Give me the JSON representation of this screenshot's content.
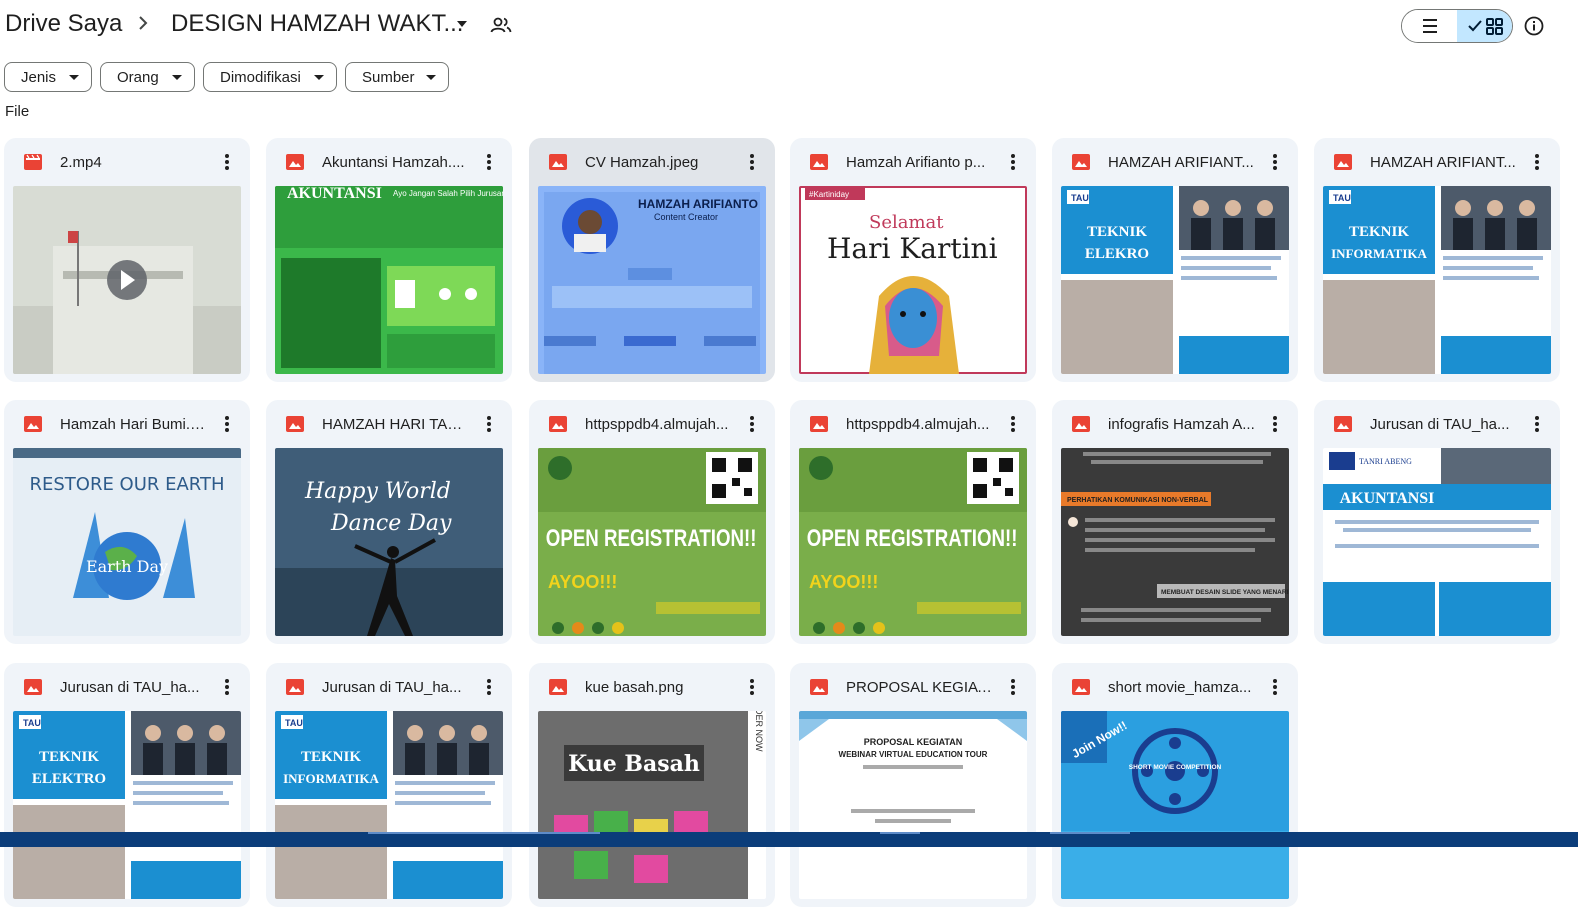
{
  "breadcrumb": {
    "root": "Drive Saya",
    "folder": "DESIGN HAMZAH WAKT..."
  },
  "filters": [
    {
      "label": "Jenis"
    },
    {
      "label": "Orang"
    },
    {
      "label": "Dimodifikasi"
    },
    {
      "label": "Sumber"
    }
  ],
  "section_label": "File",
  "view_mode": "grid",
  "colors": {
    "accent": "#c2e7ff",
    "image_icon": "#ea4335",
    "card_bg": "#f0f4f9"
  },
  "files": [
    {
      "name": "2.mp4",
      "type": "video",
      "thumb": {
        "kind": "video"
      }
    },
    {
      "name": "Akuntansi Hamzah....",
      "type": "image",
      "thumb": {
        "kind": "poster-green",
        "title": "AKUNTANSI",
        "text": "Ayo Jangan Salah Pilih Jurusan!!!"
      }
    },
    {
      "name": "CV Hamzah.jpeg",
      "type": "image",
      "selected": true,
      "thumb": {
        "kind": "cv",
        "title": "HAMZAH ARIFIANTO",
        "text": "Content Creator"
      }
    },
    {
      "name": "Hamzah Arifianto p...",
      "type": "image",
      "thumb": {
        "kind": "kartini",
        "tag": "#Kartiniday",
        "title": "Selamat",
        "text": "Hari Kartini"
      }
    },
    {
      "name": "HAMZAH ARIFIANT...",
      "type": "image",
      "thumb": {
        "kind": "tau",
        "title": "TEKNIK",
        "text": "ELEKRO"
      }
    },
    {
      "name": "HAMZAH ARIFIANT...",
      "type": "image",
      "thumb": {
        "kind": "tau",
        "title": "TEKNIK",
        "text": "INFORMATIKA"
      }
    },
    {
      "name": "Hamzah Hari Bumi.p...",
      "type": "image",
      "thumb": {
        "kind": "earth",
        "title": "RESTORE OUR EARTH",
        "text": "Earth Day"
      }
    },
    {
      "name": "HAMZAH HARI TARI ...",
      "type": "image",
      "thumb": {
        "kind": "dance",
        "title": "Happy World",
        "text": "Dance Day"
      }
    },
    {
      "name": "httpsppdb4.almujah...",
      "type": "image",
      "thumb": {
        "kind": "ppdb",
        "title": "OPEN REGISTRATION!!",
        "text": "AYOO!!!"
      }
    },
    {
      "name": "httpsppdb4.almujah...",
      "type": "image",
      "thumb": {
        "kind": "ppdb",
        "title": "OPEN REGISTRATION!!",
        "text": "AYOO!!!"
      }
    },
    {
      "name": "infografis Hamzah A...",
      "type": "image",
      "thumb": {
        "kind": "infografis",
        "title": "PERHATIKAN KOMUNIKASI NON-VERBAL",
        "text": "MEMBUAT DESAIN SLIDE YANG MENARIK"
      }
    },
    {
      "name": "Jurusan di TAU_ha...",
      "type": "image",
      "thumb": {
        "kind": "tau-wide",
        "title": "AKUNTANSI",
        "text": "TANRI ABENG"
      }
    },
    {
      "name": "Jurusan di TAU_ha...",
      "type": "image",
      "thumb": {
        "kind": "tau",
        "title": "TEKNIK",
        "text": "ELEKTRO"
      }
    },
    {
      "name": "Jurusan di TAU_ha...",
      "type": "image",
      "thumb": {
        "kind": "tau",
        "title": "TEKNIK",
        "text": "INFORMATIKA"
      }
    },
    {
      "name": "kue basah.png",
      "type": "image",
      "thumb": {
        "kind": "kue",
        "title": "Kue Basah",
        "text": "ORDER NOW"
      }
    },
    {
      "name": "PROPOSAL KEGIAT...",
      "type": "image",
      "thumb": {
        "kind": "proposal",
        "title": "PROPOSAL KEGIATAN",
        "text": "WEBINAR VIRTUAL EDUCATION TOUR"
      }
    },
    {
      "name": "short movie_hamza...",
      "type": "image",
      "thumb": {
        "kind": "movie",
        "title": "Join Now!!",
        "text": "SHORT MOVIE COMPETITION"
      }
    }
  ]
}
